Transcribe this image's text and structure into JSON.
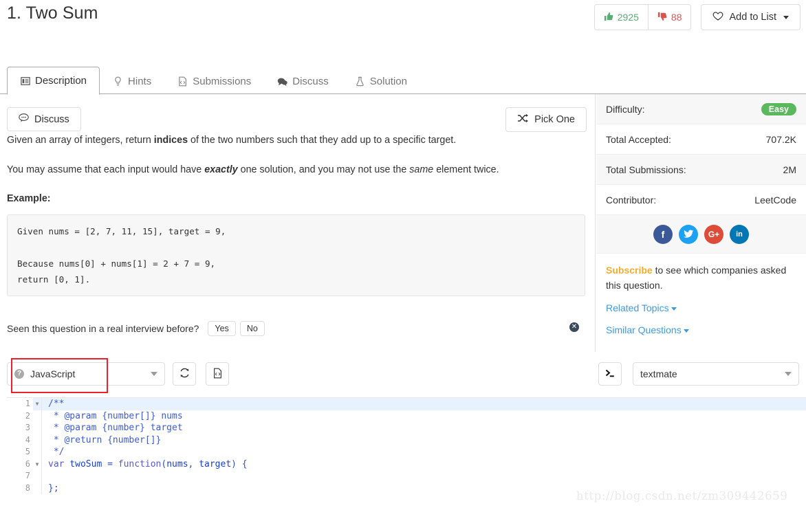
{
  "header": {
    "title": "1. Two Sum",
    "upvotes": "2925",
    "downvotes": "88",
    "add_to_list_label": "Add to List",
    "thumbs_up_icon": "thumbs-up-icon",
    "thumbs_down_icon": "thumbs-down-icon",
    "heart_icon": "heart-icon"
  },
  "tabs": [
    {
      "label": "Description",
      "icon": "description-icon",
      "active": true
    },
    {
      "label": "Hints",
      "icon": "lightbulb-icon",
      "active": false
    },
    {
      "label": "Submissions",
      "icon": "submissions-icon",
      "active": false
    },
    {
      "label": "Discuss",
      "icon": "chat-bubble-icon",
      "active": false
    },
    {
      "label": "Solution",
      "icon": "flask-icon",
      "active": false
    }
  ],
  "content": {
    "discuss_button": "Discuss",
    "pick_one_button": "Pick One",
    "paragraph1_pre": "Given an array of integers, return ",
    "paragraph1_bold": "indices",
    "paragraph1_post": " of the two numbers such that they add up to a specific target.",
    "paragraph2_pre": "You may assume that each input would have ",
    "paragraph2_bolditalic": "exactly",
    "paragraph2_mid": " one solution, and you may not use the ",
    "paragraph2_italic": "same",
    "paragraph2_post": " element twice.",
    "example_label": "Example:",
    "example_code": "Given nums = [2, 7, 11, 15], target = 9,\n\nBecause nums[0] + nums[1] = 2 + 7 = 9,\nreturn [0, 1].",
    "seen_question_text": "Seen this question in a real interview before?",
    "yes_label": "Yes",
    "no_label": "No",
    "close_icon": "close-icon"
  },
  "sidebar": {
    "rows": [
      {
        "label": "Difficulty:",
        "value": "Easy",
        "is_badge": true
      },
      {
        "label": "Total Accepted:",
        "value": "707.2K",
        "is_badge": false
      },
      {
        "label": "Total Submissions:",
        "value": "2M",
        "is_badge": false
      },
      {
        "label": "Contributor:",
        "value": "LeetCode",
        "is_badge": false
      }
    ],
    "social": [
      {
        "name": "facebook-icon",
        "glyph": "f",
        "color": "#3b5998"
      },
      {
        "name": "twitter-icon",
        "glyph": "t",
        "color": "#1da1f2"
      },
      {
        "name": "google-plus-icon",
        "glyph": "G+",
        "color": "#dd4b39"
      },
      {
        "name": "linkedin-icon",
        "glyph": "in",
        "color": "#0077b5"
      }
    ],
    "subscribe_link": "Subscribe",
    "subscribe_rest": " to see which companies asked this question.",
    "related_topics": "Related Topics",
    "similar_questions": "Similar Questions"
  },
  "editor_toolbar": {
    "language": "JavaScript",
    "help_icon": "help-icon",
    "reset_icon": "reset-icon",
    "notes_icon": "notes-icon",
    "console_icon": "console-icon",
    "theme": "textmate",
    "highlight_color": "#e8212a"
  },
  "editor": {
    "lines": [
      {
        "num": "1",
        "fold": true,
        "active": true,
        "segments": [
          {
            "cls": "tk-comment",
            "text": "/**"
          }
        ]
      },
      {
        "num": "2",
        "fold": false,
        "active": false,
        "segments": [
          {
            "cls": "tk-comment",
            "text": " * @param {number[]} nums"
          }
        ]
      },
      {
        "num": "3",
        "fold": false,
        "active": false,
        "segments": [
          {
            "cls": "tk-comment",
            "text": " * @param {number} target"
          }
        ]
      },
      {
        "num": "4",
        "fold": false,
        "active": false,
        "segments": [
          {
            "cls": "tk-comment",
            "text": " * @return {number[]}"
          }
        ]
      },
      {
        "num": "5",
        "fold": false,
        "active": false,
        "segments": [
          {
            "cls": "tk-comment",
            "text": " */"
          }
        ]
      },
      {
        "num": "6",
        "fold": true,
        "active": false,
        "segments": [
          {
            "cls": "tk-kw",
            "text": "var"
          },
          {
            "cls": "tk-id",
            "text": " twoSum "
          },
          {
            "cls": "tk-punct",
            "text": "= "
          },
          {
            "cls": "tk-kw",
            "text": "function"
          },
          {
            "cls": "tk-punct",
            "text": "("
          },
          {
            "cls": "tk-id",
            "text": "nums"
          },
          {
            "cls": "tk-punct",
            "text": ", "
          },
          {
            "cls": "tk-id",
            "text": "target"
          },
          {
            "cls": "tk-punct",
            "text": ") {"
          }
        ]
      },
      {
        "num": "7",
        "fold": false,
        "active": false,
        "segments": [
          {
            "cls": "tk-punct",
            "text": ""
          }
        ]
      },
      {
        "num": "8",
        "fold": false,
        "active": false,
        "segments": [
          {
            "cls": "tk-punct",
            "text": "};"
          }
        ]
      }
    ]
  },
  "watermark": "http://blog.csdn.net/zm309442659"
}
